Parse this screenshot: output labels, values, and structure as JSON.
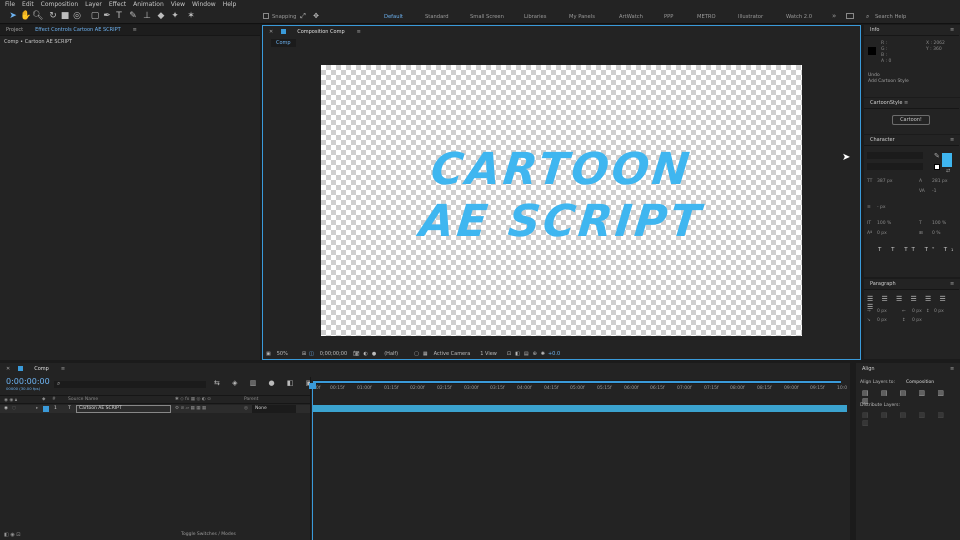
{
  "menu": [
    "File",
    "Edit",
    "Composition",
    "Layer",
    "Effect",
    "Animation",
    "View",
    "Window",
    "Help"
  ],
  "toolbar": {
    "snapping": "Snapping",
    "workspaces": [
      "Default",
      "Standard",
      "Small Screen",
      "Libraries",
      "My Panels",
      "ArtWatch",
      "PPP",
      "METRO",
      "Illustrator",
      "Watch 2.0"
    ],
    "active_workspace": "Default",
    "search_placeholder": "Search Help"
  },
  "left_panel": {
    "tabs": [
      "Project",
      "Effect Controls Cartoon AE SCRIPT"
    ],
    "subtitle": "Comp • Cartoon AE SCRIPT"
  },
  "comp_panel": {
    "tab": "Composition Comp",
    "subtab": "Comp",
    "text_line1": "CARTOON",
    "text_line2": "AE SCRIPT",
    "footer": {
      "zoom": "50%",
      "timecode": "0;00;00;00",
      "resolution": "(Half)",
      "camera": "Active Camera",
      "views": "1 View",
      "exposure": "+0.0"
    }
  },
  "info_panel": {
    "title": "Info",
    "r": "R :",
    "g": "G :",
    "b": "B :",
    "a": "A : 0",
    "x": "X : 2062",
    "y": "Y : 360",
    "undo": "Undo",
    "action": "Add Cartoon Style"
  },
  "cartoon_style": {
    "title": "CartoonStyle",
    "button": "Cartoon!"
  },
  "character": {
    "title": "Character",
    "font_size": "387 px",
    "leading": "281 px",
    "tracking": "-1",
    "stroke": "- px",
    "vscale": "100 %",
    "hscale": "100 %",
    "baseline": "0 px",
    "tsume": "0 %"
  },
  "paragraph": {
    "title": "Paragraph",
    "indent1": "0 px",
    "indent2": "0 px",
    "indent3": "0 px",
    "space1": "0 px",
    "space2": "0 px"
  },
  "timeline": {
    "tab": "Comp",
    "timecode": "0:00:00:00",
    "fps": "00000 (30.00 fps)",
    "col_source": "Source Name",
    "col_parent": "Parent",
    "layer_num": "1",
    "layer_name": "Cartoon AE SCRIPT",
    "parent_value": "None",
    "footer": "Toggle Switches / Modes",
    "ruler": [
      "00f",
      "00:15f",
      "01:00f",
      "01:15f",
      "02:00f",
      "02:15f",
      "03:00f",
      "03:15f",
      "04:00f",
      "04:15f",
      "05:00f",
      "05:15f",
      "06:00f",
      "06:15f",
      "07:00f",
      "07:15f",
      "08:00f",
      "08:15f",
      "09:00f",
      "09:15f",
      "10:0"
    ]
  },
  "align": {
    "title": "Align",
    "align_to_label": "Align Layers to:",
    "align_to_value": "Composition",
    "distribute": "Distribute Layers:"
  },
  "colors": {
    "accent": "#3a9ad9",
    "text_fill": "#3fb6f0"
  }
}
